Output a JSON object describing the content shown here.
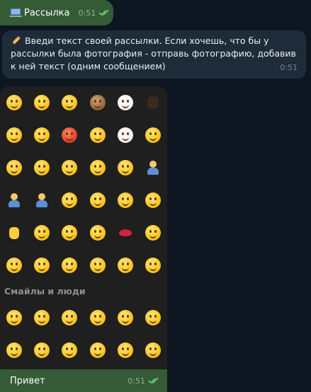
{
  "messages": {
    "out_1": {
      "text": "Рассылка",
      "time": "0:51",
      "icon": "computer-icon"
    },
    "in_1": {
      "icon": "pencil-icon",
      "text": "Введи текст своей рассылки. Если хочешь, что бы у рассылки была фотография - отправь фотографию, добавив к ней текст (одним сообщением)",
      "time": "0:51"
    },
    "photo": {
      "section_title": "Смайлы и люди",
      "caption": "Привет",
      "time": "0:51"
    }
  },
  "colors": {
    "background": "#0e1621",
    "outgoing_bubble": "#355b36",
    "incoming_bubble": "#1e2c3a",
    "keyboard_bg": "#1f1f1f"
  }
}
